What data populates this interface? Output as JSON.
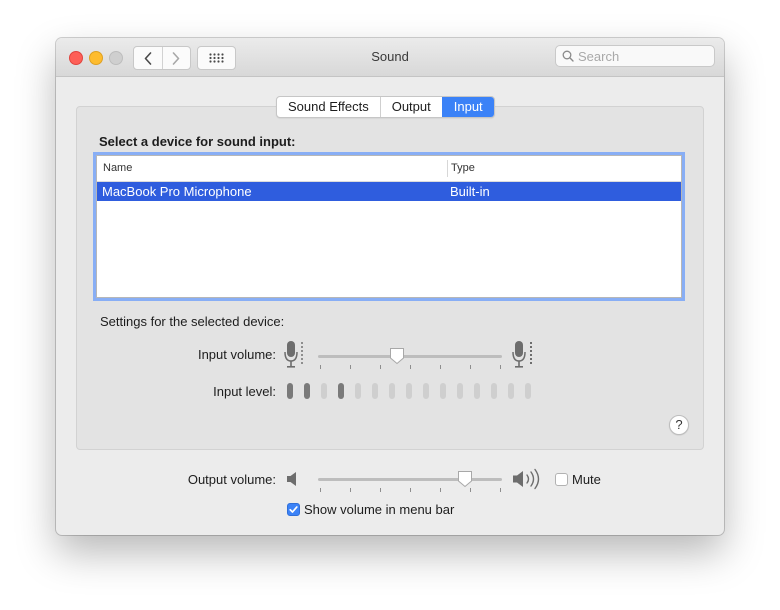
{
  "window": {
    "title": "Sound"
  },
  "toolbar": {
    "search_placeholder": "Search"
  },
  "tabs": [
    {
      "label": "Sound Effects",
      "active": false
    },
    {
      "label": "Output",
      "active": false
    },
    {
      "label": "Input",
      "active": true
    }
  ],
  "input": {
    "section_label": "Select a device for sound input:",
    "table": {
      "columns": [
        "Name",
        "Type"
      ],
      "rows": [
        {
          "name": "MacBook Pro Microphone",
          "type": "Built-in",
          "selected": true
        }
      ]
    },
    "settings_label": "Settings for the selected device:",
    "input_volume_label": "Input volume:",
    "input_volume_value": 0.43,
    "input_level_label": "Input level:",
    "input_level_bars": [
      1,
      1,
      0,
      1,
      0,
      0,
      0,
      0,
      0,
      0,
      0,
      0,
      0,
      0,
      0
    ]
  },
  "output": {
    "volume_label": "Output volume:",
    "volume_value": 0.8,
    "mute_label": "Mute",
    "mute_checked": false
  },
  "menu_bar": {
    "label": "Show volume in menu bar",
    "checked": true
  },
  "colors": {
    "accent": "#3b82f7",
    "selection": "#2f5dde",
    "close": "#fe5f57",
    "minimize": "#febc2e"
  }
}
